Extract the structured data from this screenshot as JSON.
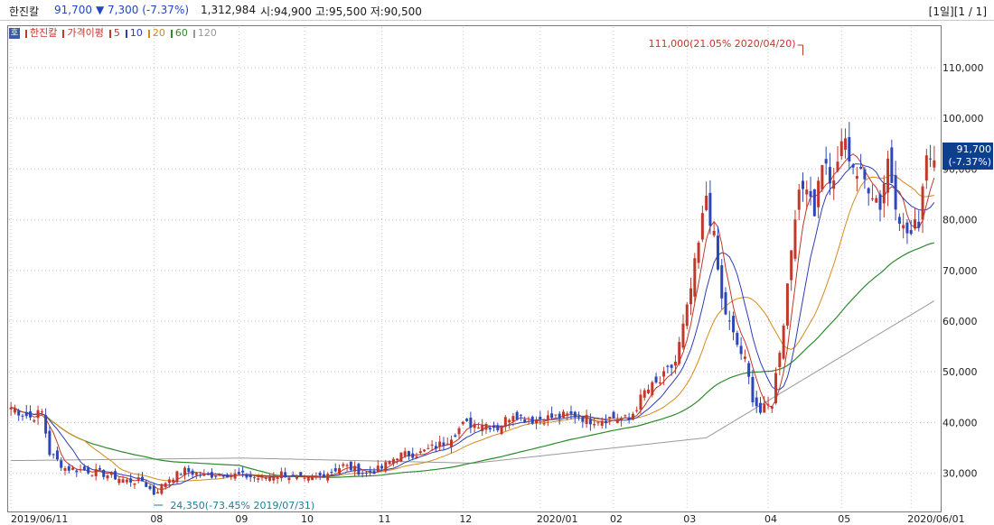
{
  "header": {
    "stock_name": "한진칼",
    "price": "91,700",
    "change": "▼ 7,300 (-7.37%)",
    "volume": "1,312,984",
    "ohl": "시:94,900 고:95,500 저:90,500",
    "page_info": "[1일][1 / 1]"
  },
  "legend": {
    "mode_icon": "호",
    "stock_label": "한진칼",
    "ma_title": "가격이평",
    "ma_items": [
      {
        "label": "5",
        "color": "#c0392b"
      },
      {
        "label": "10",
        "color": "#2e3cb5"
      },
      {
        "label": "20",
        "color": "#d68a1a"
      },
      {
        "label": "60",
        "color": "#2e8b2e"
      },
      {
        "label": "120",
        "color": "#9a9a9a"
      }
    ]
  },
  "current_price_tag": {
    "price": "91,700",
    "change": "(-7.37%)"
  },
  "annotations": {
    "high": "111,000(21.05% 2020/04/20)",
    "low": "24,350(-73.45% 2019/07/31)"
  },
  "colors": {
    "up": "#c0392b",
    "down": "#2e47b8",
    "grid": "#c8c8c8"
  },
  "chart_data": {
    "type": "candlestick",
    "ylim": [
      23000,
      118000
    ],
    "y_ticks": [
      30000,
      40000,
      50000,
      60000,
      70000,
      80000,
      90000,
      100000,
      110000
    ],
    "y_tick_labels": [
      "30,000",
      "40,000",
      "50,000",
      "60,000",
      "70,000",
      "80,000",
      "90,000",
      "100,000",
      "110,000"
    ],
    "x_labels": [
      {
        "label": "2019/06/11",
        "index": 0
      },
      {
        "label": "08",
        "index": 37
      },
      {
        "label": "09",
        "index": 59
      },
      {
        "label": "10",
        "index": 76
      },
      {
        "label": "11",
        "index": 96
      },
      {
        "label": "12",
        "index": 117
      },
      {
        "label": "2020/01",
        "index": 137
      },
      {
        "label": "02",
        "index": 156
      },
      {
        "label": "03",
        "index": 175
      },
      {
        "label": "04",
        "index": 196
      },
      {
        "label": "05",
        "index": 215
      },
      {
        "label": "2020/06/01",
        "index": 233
      }
    ],
    "n_days": 240,
    "anchors": [
      [
        0,
        43000
      ],
      [
        5,
        41000
      ],
      [
        8,
        42000
      ],
      [
        10,
        34000
      ],
      [
        14,
        31000
      ],
      [
        20,
        30500
      ],
      [
        26,
        29500
      ],
      [
        30,
        28500
      ],
      [
        34,
        28500
      ],
      [
        37,
        26000
      ],
      [
        41,
        29000
      ],
      [
        45,
        30500
      ],
      [
        50,
        29500
      ],
      [
        55,
        30000
      ],
      [
        60,
        29500
      ],
      [
        65,
        29000
      ],
      [
        70,
        30000
      ],
      [
        76,
        28500
      ],
      [
        80,
        29500
      ],
      [
        86,
        31500
      ],
      [
        92,
        30000
      ],
      [
        96,
        31000
      ],
      [
        100,
        33500
      ],
      [
        106,
        34000
      ],
      [
        112,
        36000
      ],
      [
        117,
        39500
      ],
      [
        122,
        40000
      ],
      [
        126,
        39000
      ],
      [
        130,
        42000
      ],
      [
        134,
        40500
      ],
      [
        140,
        41000
      ],
      [
        146,
        41500
      ],
      [
        150,
        40500
      ],
      [
        156,
        41000
      ],
      [
        160,
        40500
      ],
      [
        164,
        46000
      ],
      [
        168,
        48000
      ],
      [
        172,
        52000
      ],
      [
        175,
        62000
      ],
      [
        178,
        75000
      ],
      [
        180,
        85000
      ],
      [
        182,
        76000
      ],
      [
        184,
        64000
      ],
      [
        187,
        57000
      ],
      [
        190,
        52000
      ],
      [
        192,
        45000
      ],
      [
        194,
        42000
      ],
      [
        197,
        44000
      ],
      [
        200,
        60000
      ],
      [
        203,
        82000
      ],
      [
        206,
        88000
      ],
      [
        208,
        82000
      ],
      [
        210,
        92000
      ],
      [
        213,
        86000
      ],
      [
        215,
        96000
      ],
      [
        217,
        93000
      ],
      [
        219,
        89000
      ],
      [
        222,
        87000
      ],
      [
        225,
        83000
      ],
      [
        227,
        92000
      ],
      [
        229,
        84000
      ],
      [
        231,
        78000
      ],
      [
        233,
        77000
      ],
      [
        235,
        80000
      ],
      [
        237,
        94000
      ],
      [
        239,
        91000
      ]
    ],
    "ma120_anchors": [
      [
        0,
        32500
      ],
      [
        60,
        33000
      ],
      [
        120,
        32000
      ],
      [
        180,
        37000
      ],
      [
        239,
        64000
      ]
    ],
    "high_point": {
      "index": 205,
      "value": 111000
    },
    "low_point": {
      "index": 37,
      "value": 24350
    },
    "last_close": 91700
  }
}
